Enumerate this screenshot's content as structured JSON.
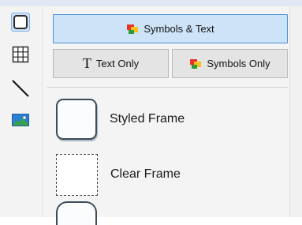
{
  "toolbar": {
    "tools": [
      {
        "icon": "styled-frame-icon",
        "selected": true
      },
      {
        "icon": "table-icon",
        "selected": false
      },
      {
        "icon": "line-icon",
        "selected": false
      },
      {
        "icon": "image-icon",
        "selected": false
      }
    ]
  },
  "display_mode": {
    "symbols_and_text": "Symbols & Text",
    "text_only": "Text Only",
    "symbols_only": "Symbols Only",
    "text_only_glyph": "T",
    "selected": "symbols_and_text"
  },
  "frames": [
    {
      "label": "Styled Frame"
    },
    {
      "label": "Clear Frame"
    }
  ],
  "colors": {
    "selected_fill": "#cde4f8",
    "selected_border": "#4a8ed6",
    "button_fill": "#e4e4e4",
    "panel_bg": "#f4f4f4"
  }
}
